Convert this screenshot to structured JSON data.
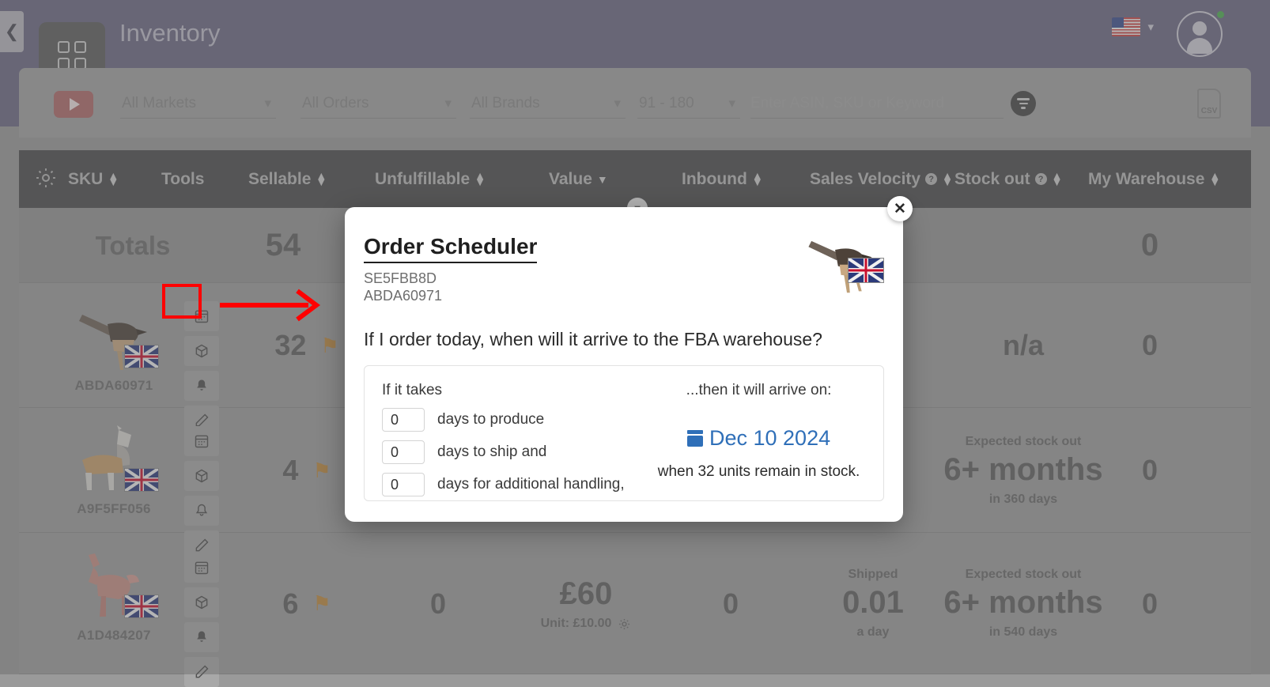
{
  "header": {
    "collapse_icon": "chevron-left-icon",
    "app_logo_icon": "grid-apps-icon",
    "title": "Inventory",
    "language_flag": "us-flag-icon",
    "language_chevron": "chevron-down-icon",
    "avatar_icon": "user-avatar-icon"
  },
  "toolbar": {
    "video_button_icon": "play-video-icon",
    "filters": [
      {
        "name": "markets",
        "value": "All Markets"
      },
      {
        "name": "orders",
        "value": "All Orders"
      },
      {
        "name": "brands",
        "value": "All Brands"
      },
      {
        "name": "days",
        "value": "91 - 180"
      }
    ],
    "search_placeholder": "Enter ASIN, SKU or Keyword",
    "search_value": "",
    "filter_icon": "filter-funnel-icon",
    "export_label": "CSV"
  },
  "table": {
    "settings_icon": "gear-icon",
    "columns": [
      {
        "label": "SKU",
        "sort": "sortable"
      },
      {
        "label": "Tools",
        "sort": "none"
      },
      {
        "label": "Sellable",
        "sort": "sortable"
      },
      {
        "label": "Unfulfillable",
        "sort": "sortable"
      },
      {
        "label": "Value",
        "sort": "desc"
      },
      {
        "label": "Inbound",
        "sort": "sortable"
      },
      {
        "label": "Sales Velocity",
        "sort": "sortable",
        "help": "?"
      },
      {
        "label": "Stock out",
        "sort": "sortable",
        "help": "?"
      },
      {
        "label": "My Warehouse",
        "sort": "sortable"
      }
    ],
    "totals_row": {
      "label": "Totals",
      "sellable": "54",
      "my_warehouse": "0"
    },
    "rows": [
      {
        "sku": "ABDA60971",
        "marketplace_flag": "uk-flag-icon",
        "tools": [
          "order-scheduler-icon",
          "box-icon",
          "bell-icon",
          "edit-pencil-icon"
        ],
        "sellable": "32",
        "sellable_flag": "orange-flag-icon",
        "unfulfillable": "",
        "value": "",
        "value_unit": "",
        "inbound": "",
        "velocity_label": "",
        "velocity": "",
        "velocity_sub": "",
        "stockout_label": "",
        "stockout": "n/a",
        "stockout_sub": "",
        "my_warehouse": "0"
      },
      {
        "sku": "A9F5FF056",
        "marketplace_flag": "uk-flag-icon",
        "tools": [
          "order-scheduler-icon",
          "box-icon",
          "bell-icon",
          "edit-pencil-icon"
        ],
        "sellable": "4",
        "sellable_flag": "orange-flag-icon",
        "unfulfillable": "",
        "value": "",
        "value_unit": "",
        "inbound": "",
        "velocity_label": "",
        "velocity": "",
        "velocity_sub": "",
        "stockout_label": "Expected stock out",
        "stockout": "6+ months",
        "stockout_sub": "in 360 days",
        "my_warehouse": "0"
      },
      {
        "sku": "A1D484207",
        "marketplace_flag": "uk-flag-icon",
        "tools": [
          "order-scheduler-icon",
          "box-icon",
          "bell-icon",
          "edit-pencil-icon"
        ],
        "sellable": "6",
        "sellable_flag": "orange-flag-icon",
        "unfulfillable": "0",
        "value": "£60",
        "value_unit": "Unit: £10.00",
        "value_unit_icon": "gear-icon",
        "inbound": "0",
        "velocity_label": "Shipped",
        "velocity": "0.01",
        "velocity_sub": "a day",
        "stockout_label": "Expected stock out",
        "stockout": "6+ months",
        "stockout_sub": "in 540 days",
        "my_warehouse": "0"
      }
    ]
  },
  "modal": {
    "close_icon": "close-icon",
    "title": "Order Scheduler",
    "sku_line1": "SE5FBB8D",
    "sku_line2": "ABDA60971",
    "thumbnail_icon": "product-bird-thumbnail",
    "marketplace_flag": "uk-flag-icon",
    "question": "If I order today, when will it arrive to the FBA warehouse?",
    "left_heading": "If it takes",
    "fields": [
      {
        "name": "produce",
        "value": "0",
        "label": "days to produce"
      },
      {
        "name": "ship",
        "value": "0",
        "label": "days to ship and"
      },
      {
        "name": "handling",
        "value": "0",
        "label": "days for additional handling,"
      }
    ],
    "right_heading": "...then it will arrive on:",
    "calendar_icon": "calendar-icon",
    "arrival_date": "Dec 10 2024",
    "stock_note": "when 32 units remain in stock."
  },
  "annotations": {
    "highlight_box_target": "order-scheduler-tool-button",
    "arrow": "red-arrow-pointing-right",
    "color": "#ff0000"
  }
}
